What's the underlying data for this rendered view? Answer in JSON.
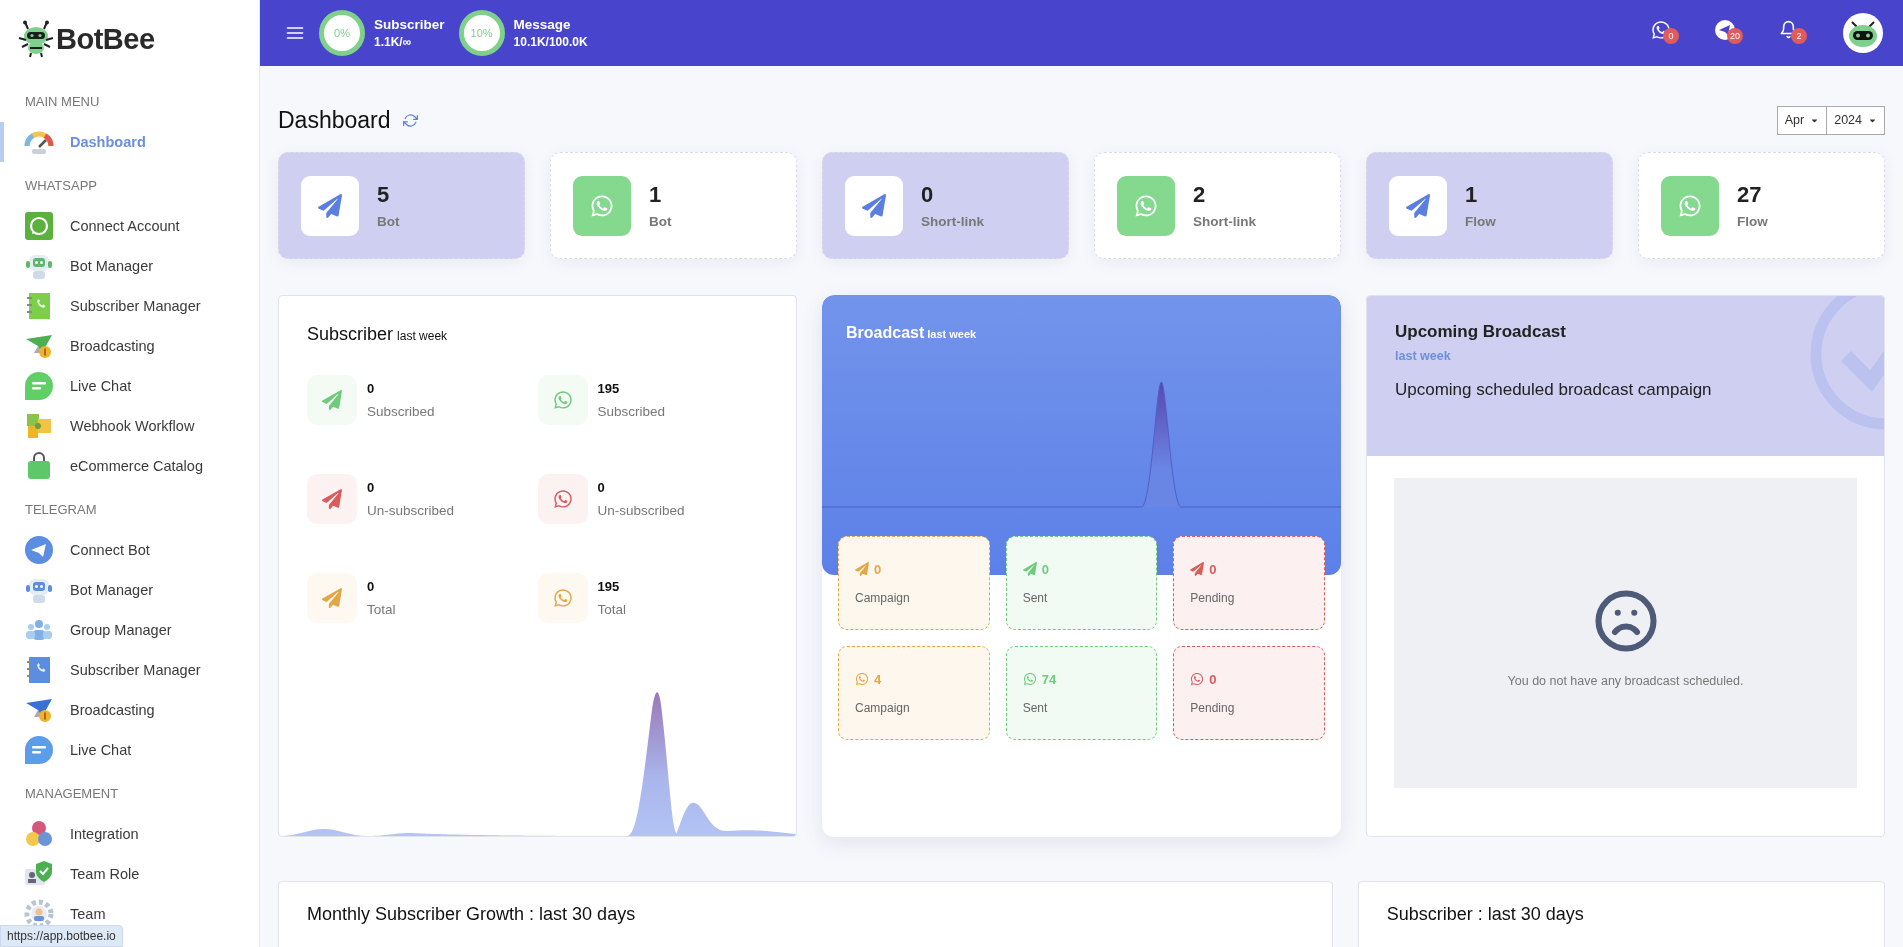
{
  "brand": {
    "name": "BotBee"
  },
  "sidebar": {
    "sections": [
      {
        "heading": "MAIN MENU",
        "items": [
          {
            "label": "Dashboard",
            "selected": true
          }
        ]
      },
      {
        "heading": "WHATSAPP",
        "items": [
          {
            "label": "Connect Account",
            "selected": false
          },
          {
            "label": "Bot Manager",
            "selected": false
          },
          {
            "label": "Subscriber Manager",
            "selected": false
          },
          {
            "label": "Broadcasting",
            "selected": false
          },
          {
            "label": "Live Chat",
            "selected": false
          },
          {
            "label": "Webhook Workflow",
            "selected": false
          },
          {
            "label": "eCommerce Catalog",
            "selected": false
          }
        ]
      },
      {
        "heading": "TELEGRAM",
        "items": [
          {
            "label": "Connect Bot",
            "selected": false
          },
          {
            "label": "Bot Manager",
            "selected": false
          },
          {
            "label": "Group Manager",
            "selected": false
          },
          {
            "label": "Subscriber Manager",
            "selected": false
          },
          {
            "label": "Broadcasting",
            "selected": false
          },
          {
            "label": "Live Chat",
            "selected": false
          }
        ]
      },
      {
        "heading": "MANAGEMENT",
        "items": [
          {
            "label": "Integration",
            "selected": false
          },
          {
            "label": "Team Role",
            "selected": false
          },
          {
            "label": "Team",
            "selected": false
          }
        ]
      }
    ]
  },
  "status_url": "https://app.botbee.io",
  "topbar": {
    "usage": [
      {
        "label": "Subscriber",
        "value": "1.1K/∞",
        "percent": "0%"
      },
      {
        "label": "Message",
        "value": "10.1K/100.0K",
        "percent": "10%"
      }
    ],
    "notifications": [
      {
        "kind": "whatsapp",
        "count": "0"
      },
      {
        "kind": "telegram",
        "count": "20"
      },
      {
        "kind": "bell",
        "count": "2"
      }
    ]
  },
  "page": {
    "title": "Dashboard",
    "month": "Apr",
    "year": "2024"
  },
  "stat_cards": [
    {
      "kind": "telegram",
      "value": "5",
      "label": "Bot"
    },
    {
      "kind": "whatsapp",
      "value": "1",
      "label": "Bot"
    },
    {
      "kind": "telegram",
      "value": "0",
      "label": "Short-link"
    },
    {
      "kind": "whatsapp",
      "value": "2",
      "label": "Short-link"
    },
    {
      "kind": "telegram",
      "value": "1",
      "label": "Flow"
    },
    {
      "kind": "whatsapp",
      "value": "27",
      "label": "Flow"
    }
  ],
  "subscriber_card": {
    "title": "Subscriber",
    "subtitle": "last week",
    "stats": [
      {
        "kind": "telegram",
        "color": "#6fcb7b",
        "value": "0",
        "label": "Subscribed"
      },
      {
        "kind": "whatsapp",
        "color": "#6fcb7b",
        "value": "195",
        "label": "Subscribed"
      },
      {
        "kind": "telegram",
        "color": "#d95c5c",
        "value": "0",
        "label": "Un-subscribed"
      },
      {
        "kind": "whatsapp",
        "color": "#d95c5c",
        "value": "0",
        "label": "Un-subscribed"
      },
      {
        "kind": "telegram",
        "color": "#e2a745",
        "value": "0",
        "label": "Total"
      },
      {
        "kind": "whatsapp",
        "color": "#e2a745",
        "value": "195",
        "label": "Total"
      }
    ]
  },
  "broadcast_card": {
    "title": "Broadcast",
    "subtitle": "last week",
    "tiles": [
      {
        "kind": "telegram",
        "color": "#e2a745",
        "value": "0",
        "label": "Campaign"
      },
      {
        "kind": "telegram",
        "color": "#6fcb7b",
        "value": "0",
        "label": "Sent"
      },
      {
        "kind": "telegram",
        "color": "#d95c5c",
        "value": "0",
        "label": "Pending"
      },
      {
        "kind": "whatsapp",
        "color": "#e2a745",
        "value": "4",
        "label": "Campaign"
      },
      {
        "kind": "whatsapp",
        "color": "#6fcb7b",
        "value": "74",
        "label": "Sent"
      },
      {
        "kind": "whatsapp",
        "color": "#d95c5c",
        "value": "0",
        "label": "Pending"
      }
    ]
  },
  "upcoming_card": {
    "title": "Upcoming Broadcast",
    "subtitle": "last week",
    "description": "Upcoming scheduled broadcast campaign",
    "empty_message": "You do not have any broadcast scheduled."
  },
  "bottom_cards": [
    {
      "title": "Monthly Subscriber Growth : last 30 days"
    },
    {
      "title": "Subscriber : last 30 days"
    }
  ]
}
